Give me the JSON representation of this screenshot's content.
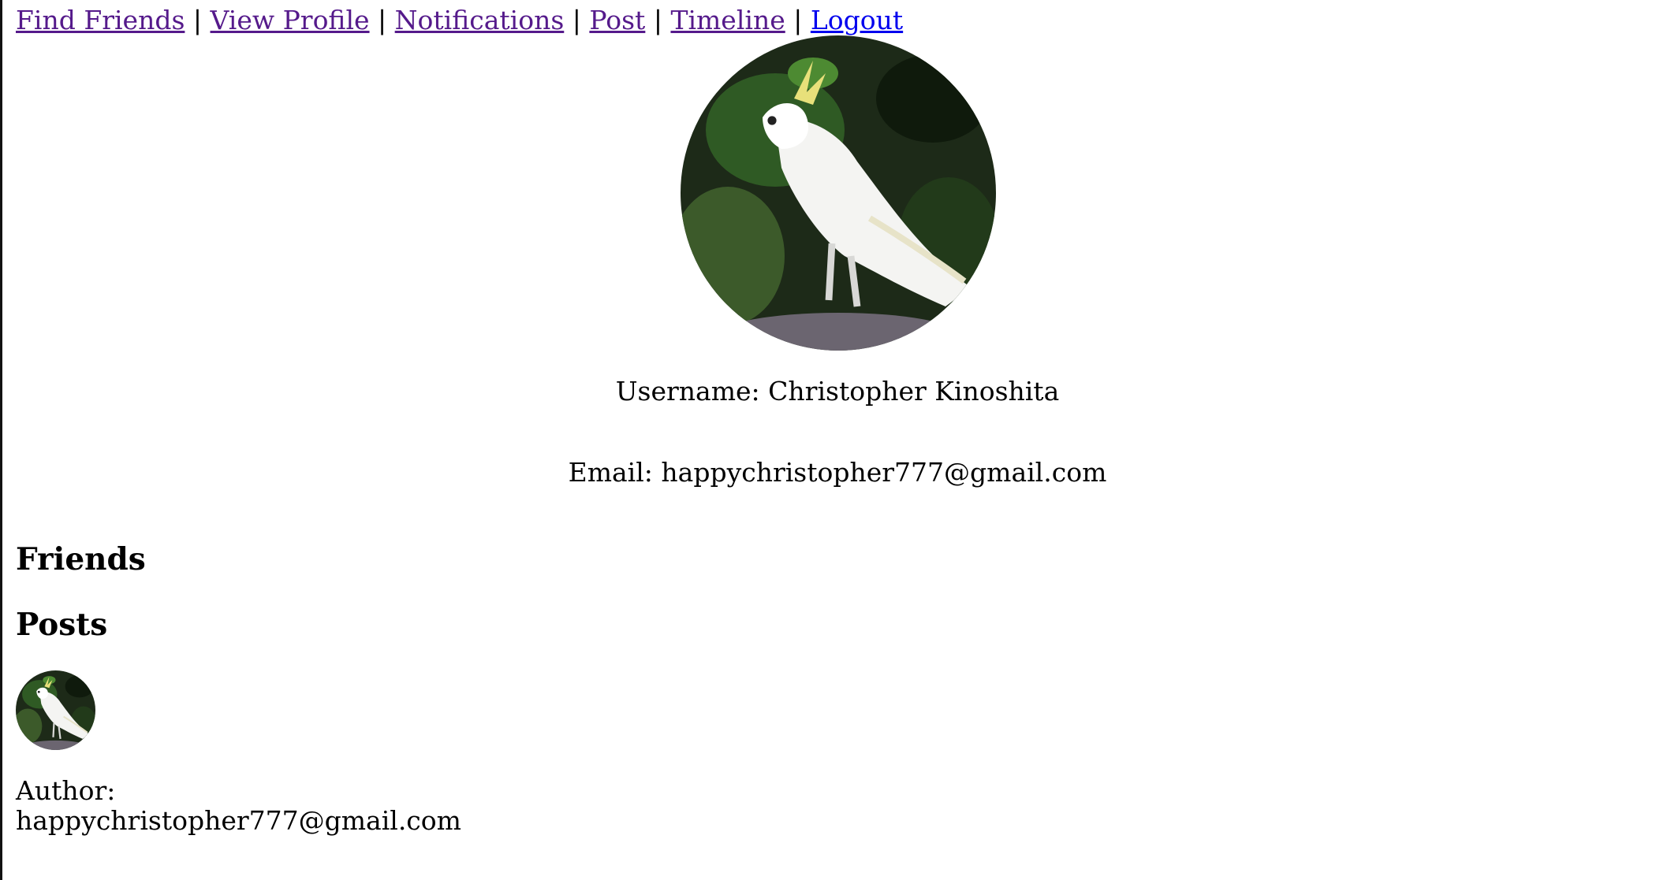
{
  "nav": {
    "links": [
      {
        "label": "Find Friends"
      },
      {
        "label": "View Profile"
      },
      {
        "label": "Notifications"
      },
      {
        "label": "Post"
      },
      {
        "label": "Timeline"
      },
      {
        "label": "Logout"
      }
    ],
    "separator": "|"
  },
  "profile": {
    "avatar": "cockatoo-photo",
    "username_label": "Username:",
    "username": "Christopher Kinoshita",
    "email_label": "Email:",
    "email": "happychristopher777@gmail.com"
  },
  "friends": {
    "heading": "Friends"
  },
  "posts": {
    "heading": "Posts",
    "items": [
      {
        "avatar": "cockatoo-photo",
        "author_label": "Author:",
        "author": "happychristopher777@gmail.com"
      }
    ]
  },
  "colors": {
    "link_visited": "#551a8b",
    "link_unvisited": "#0000ee"
  }
}
